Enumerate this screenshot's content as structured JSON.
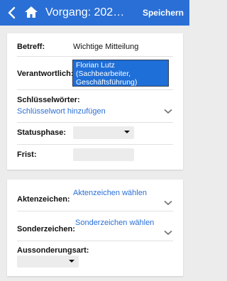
{
  "header": {
    "title": "Vorgang: 202…",
    "save_label": "Speichern",
    "bg_color": "#2a6fd6"
  },
  "form": {
    "betreff": {
      "label": "Betreff:",
      "value": "Wichtige Mitteilung"
    },
    "verantwortlich": {
      "label": "Verantwortlich:",
      "selected_lines": [
        "Florian Lutz",
        "(Sachbearbeiter,",
        "Geschäftsführung)"
      ]
    },
    "schluesselwoerter": {
      "label": "Schlüsselwörter:",
      "link": "Schlüsselwort hinzufügen"
    },
    "statusphase": {
      "label": "Statusphase:",
      "value": ""
    },
    "frist": {
      "label": "Frist:",
      "value": ""
    }
  },
  "form2": {
    "aktenzeichen": {
      "label": "Aktenzeichen:",
      "link": "Aktenzeichen wählen"
    },
    "sonderzeichen": {
      "label": "Sonderzeichen:",
      "link": "Sonderzeichen wählen"
    },
    "aussonderungsart": {
      "label": "Aussonderungsart:",
      "value": ""
    }
  }
}
